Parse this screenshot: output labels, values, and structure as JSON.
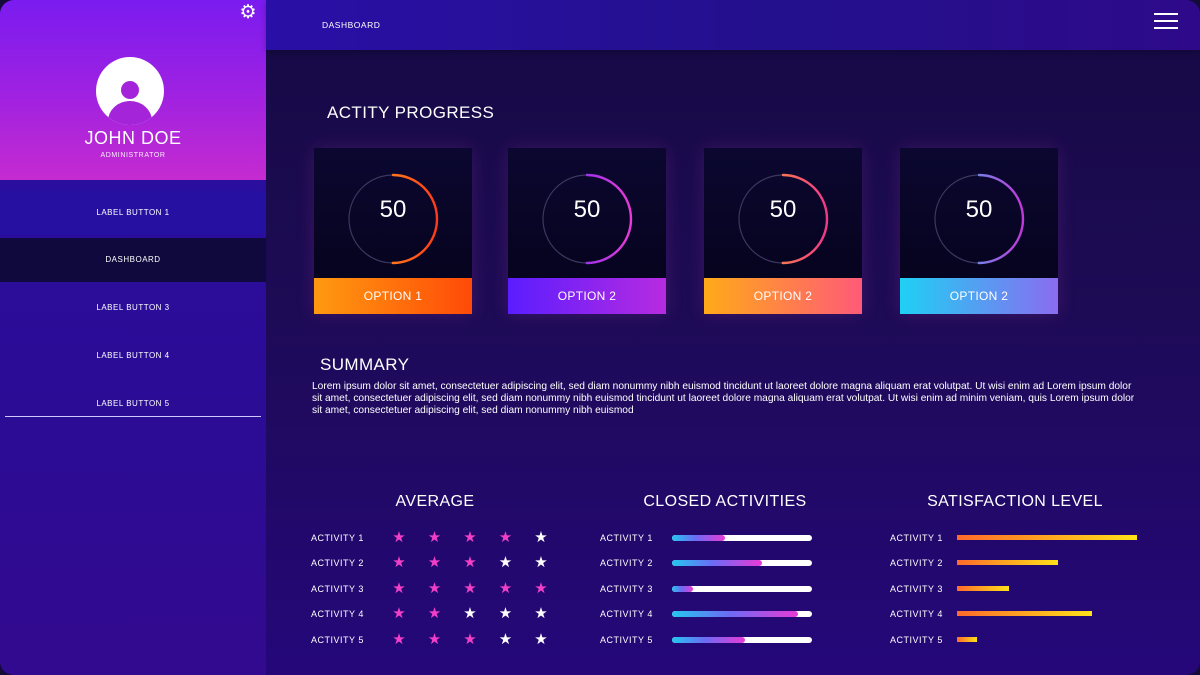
{
  "sidebar": {
    "profile": {
      "name": "JOHN DOE",
      "role": "ADMINISTRATOR"
    },
    "items": [
      {
        "label": "LABEL BUTTON 1"
      },
      {
        "label": "DASHBOARD"
      },
      {
        "label": "LABEL BUTTON 3"
      },
      {
        "label": "LABEL BUTTON 4"
      },
      {
        "label": "LABEL BUTTON 5"
      }
    ],
    "active_index": 1
  },
  "header": {
    "title": "DASHBOARD"
  },
  "activity": {
    "title": "ACTITY PROGRESS",
    "cards": [
      {
        "value": "50",
        "button": "OPTION 1",
        "ring_colors": [
          "#ffb21f",
          "#ff3a1a"
        ],
        "button_colors": [
          "#ff9a10",
          "#ff4a08"
        ]
      },
      {
        "value": "50",
        "button": "OPTION 2",
        "ring_colors": [
          "#5a2cff",
          "#e83ad6"
        ],
        "button_colors": [
          "#5b1dff",
          "#b72be0"
        ]
      },
      {
        "value": "50",
        "button": "OPTION 2",
        "ring_colors": [
          "#ffb21f",
          "#f0388a"
        ],
        "button_colors": [
          "#ffaa18",
          "#ff5a78"
        ]
      },
      {
        "value": "50",
        "button": "OPTION 2",
        "ring_colors": [
          "#30c6f4",
          "#c038d8"
        ],
        "button_colors": [
          "#1fd0f4",
          "#8a6cf0"
        ]
      }
    ],
    "progress": 0.5
  },
  "summary": {
    "title": "SUMMARY",
    "text": "Lorem ipsum dolor sit amet, consectetuer adipiscing elit, sed diam nonummy nibh euismod tincidunt ut laoreet dolore magna aliquam erat volutpat. Ut wisi enim ad Lorem ipsum dolor sit amet, consectetuer adipiscing elit, sed diam nonummy nibh euismod tincidunt ut laoreet dolore magna aliquam erat volutpat. Ut wisi enim ad minim veniam, quis Lorem ipsum dolor sit amet, consectetuer adipiscing elit, sed diam nonummy nibh euismod"
  },
  "average": {
    "title": "AVERAGE",
    "rows": [
      {
        "label": "ACTIVITY 1",
        "stars": 4
      },
      {
        "label": "ACTIVITY 2",
        "stars": 3
      },
      {
        "label": "ACTIVITY 3",
        "stars": 5
      },
      {
        "label": "ACTIVITY 4",
        "stars": 2
      },
      {
        "label": "ACTIVITY 5",
        "stars": 3
      }
    ],
    "max_stars": 5
  },
  "closed": {
    "title": "CLOSED ACTIVITIES",
    "rows": [
      {
        "label": "ACTIVITY 1",
        "value": 0.38
      },
      {
        "label": "ACTIVITY 2",
        "value": 0.64
      },
      {
        "label": "ACTIVITY 3",
        "value": 0.15
      },
      {
        "label": "ACTIVITY 4",
        "value": 0.9
      },
      {
        "label": "ACTIVITY 5",
        "value": 0.52
      }
    ]
  },
  "satisfaction": {
    "title": "SATISFACTION LEVEL",
    "rows": [
      {
        "label": "ACTIVITY 1",
        "value": 1.0
      },
      {
        "label": "ACTIVITY 2",
        "value": 0.56
      },
      {
        "label": "ACTIVITY 3",
        "value": 0.29
      },
      {
        "label": "ACTIVITY 4",
        "value": 0.75
      },
      {
        "label": "ACTIVITY 5",
        "value": 0.11
      }
    ]
  },
  "colors": {
    "star_filled": "#f23fc8",
    "star_empty": "#ffffff"
  }
}
